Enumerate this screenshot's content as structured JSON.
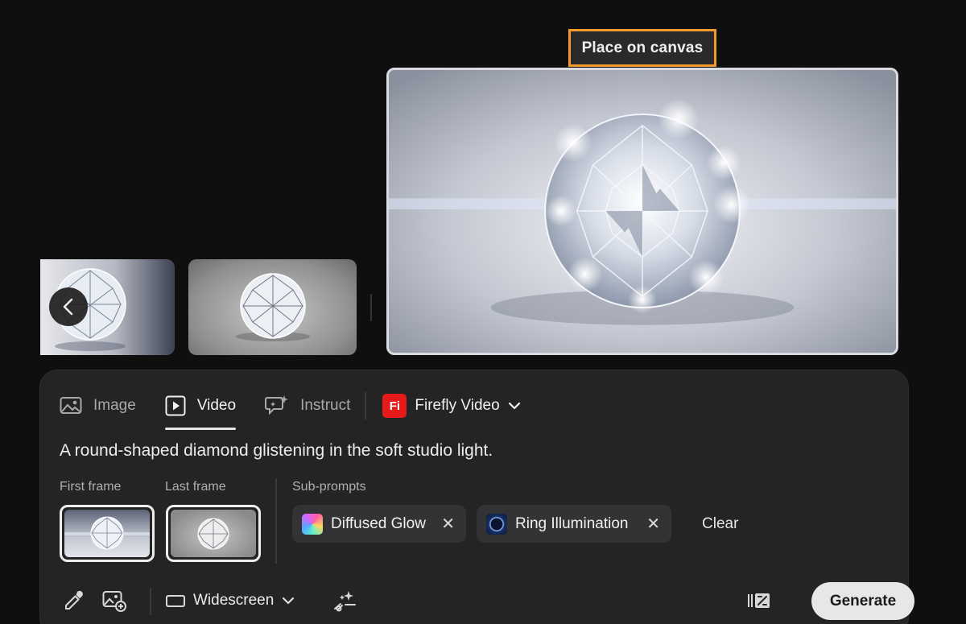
{
  "canvas": {
    "place_label": "Place on canvas"
  },
  "tabs": [
    {
      "label": "Image",
      "icon": "image-icon",
      "active": false
    },
    {
      "label": "Video",
      "icon": "play-icon",
      "active": true
    },
    {
      "label": "Instruct",
      "icon": "sparkle-chat-icon",
      "active": false
    }
  ],
  "model": {
    "logo": "Fi",
    "name": "Firefly Video"
  },
  "prompt": {
    "text": "A round-shaped diamond glistening in the soft studio light."
  },
  "frames": {
    "first_label": "First frame",
    "last_label": "Last frame"
  },
  "subprompts": {
    "label": "Sub-prompts",
    "items": [
      {
        "label": "Diffused Glow",
        "close": "✕"
      },
      {
        "label": "Ring Illumination",
        "close": "✕"
      }
    ],
    "clear_label": "Clear"
  },
  "toolbar": {
    "aspect_label": "Widescreen",
    "generate_label": "Generate"
  }
}
